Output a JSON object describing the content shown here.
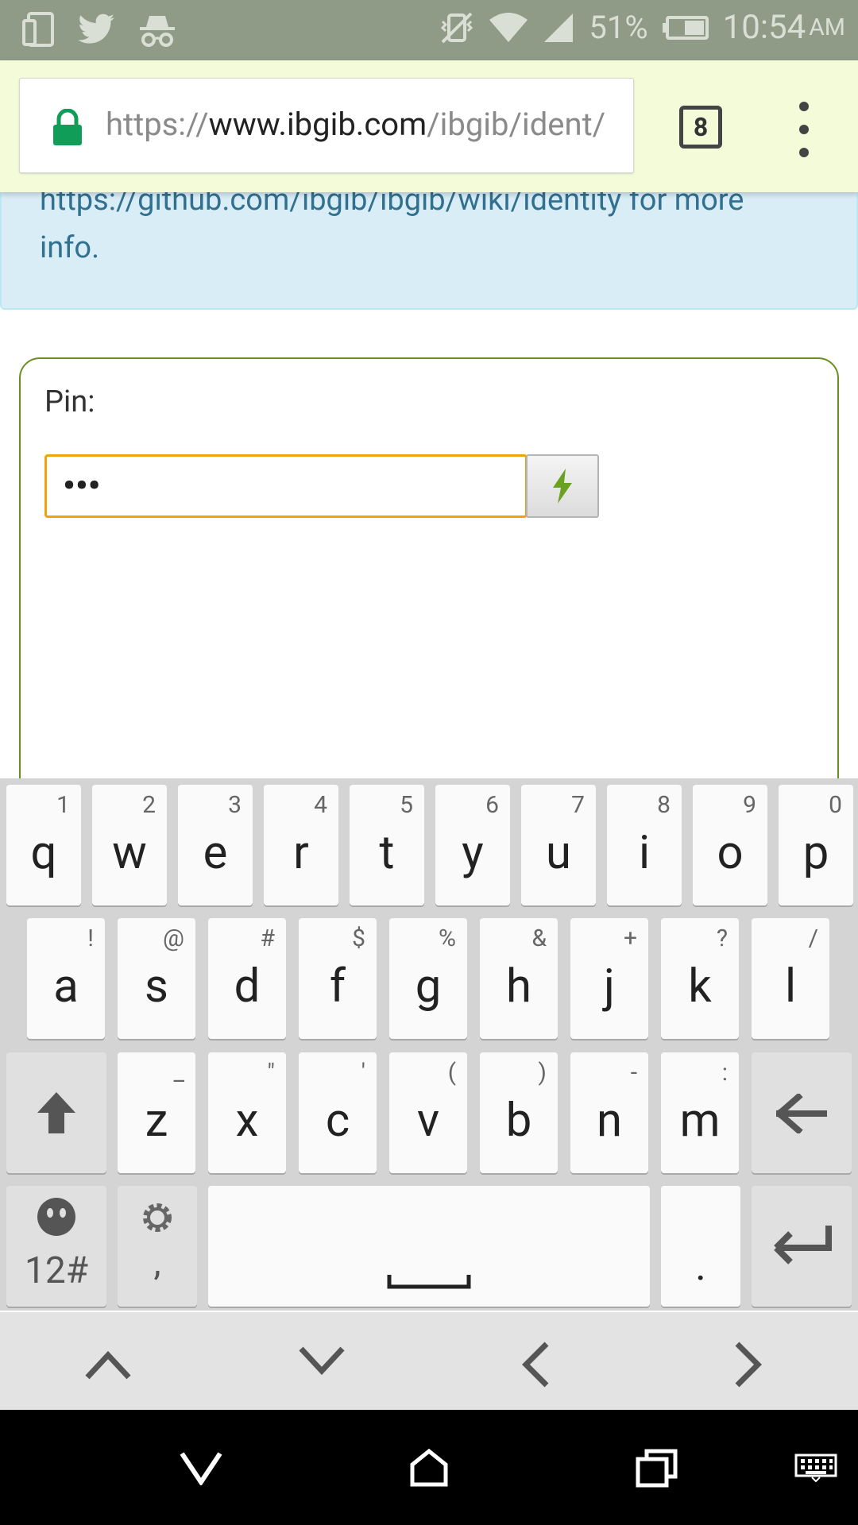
{
  "status_bar": {
    "battery": "51%",
    "time": "10:54",
    "ampm": "AM",
    "icons": [
      "screen-mirror-icon",
      "twitter-icon",
      "incognito-icon",
      "vibrate-off-icon",
      "wifi-icon",
      "signal-icon",
      "battery-icon"
    ]
  },
  "browser": {
    "url_scheme": "https://",
    "url_host": "www.ibgib.com",
    "url_path": "/ibgib/ident/",
    "tab_count": "8"
  },
  "info": {
    "text_line1": "https://github.com/ibgib/ibgib/wiki/identity for more",
    "text_line2": "info."
  },
  "form": {
    "pin_label": "Pin:",
    "pin_value": "•••"
  },
  "keyboard": {
    "row1": [
      {
        "main": "q",
        "alt": "1"
      },
      {
        "main": "w",
        "alt": "2"
      },
      {
        "main": "e",
        "alt": "3"
      },
      {
        "main": "r",
        "alt": "4"
      },
      {
        "main": "t",
        "alt": "5"
      },
      {
        "main": "y",
        "alt": "6"
      },
      {
        "main": "u",
        "alt": "7"
      },
      {
        "main": "i",
        "alt": "8"
      },
      {
        "main": "o",
        "alt": "9"
      },
      {
        "main": "p",
        "alt": "0"
      }
    ],
    "row2": [
      {
        "main": "a",
        "alt": "!"
      },
      {
        "main": "s",
        "alt": "@"
      },
      {
        "main": "d",
        "alt": "#"
      },
      {
        "main": "f",
        "alt": "$"
      },
      {
        "main": "g",
        "alt": "%"
      },
      {
        "main": "h",
        "alt": "&"
      },
      {
        "main": "j",
        "alt": "+"
      },
      {
        "main": "k",
        "alt": "?"
      },
      {
        "main": "l",
        "alt": "/"
      }
    ],
    "row3": [
      {
        "main": "z",
        "alt": "_"
      },
      {
        "main": "x",
        "alt": "\""
      },
      {
        "main": "c",
        "alt": "'"
      },
      {
        "main": "v",
        "alt": "("
      },
      {
        "main": "b",
        "alt": ")"
      },
      {
        "main": "n",
        "alt": "-"
      },
      {
        "main": "m",
        "alt": ":"
      }
    ],
    "symbols_label": "12#",
    "comma": ",",
    "period": "."
  },
  "colors": {
    "status_bar": "#8f9a87",
    "browser_bar": "#f3fbd8",
    "info_bg": "#d9edf7",
    "info_text": "#31708f",
    "card_border": "#6b8e23",
    "input_focus": "#f0a30a",
    "bolt": "#6aa121"
  }
}
